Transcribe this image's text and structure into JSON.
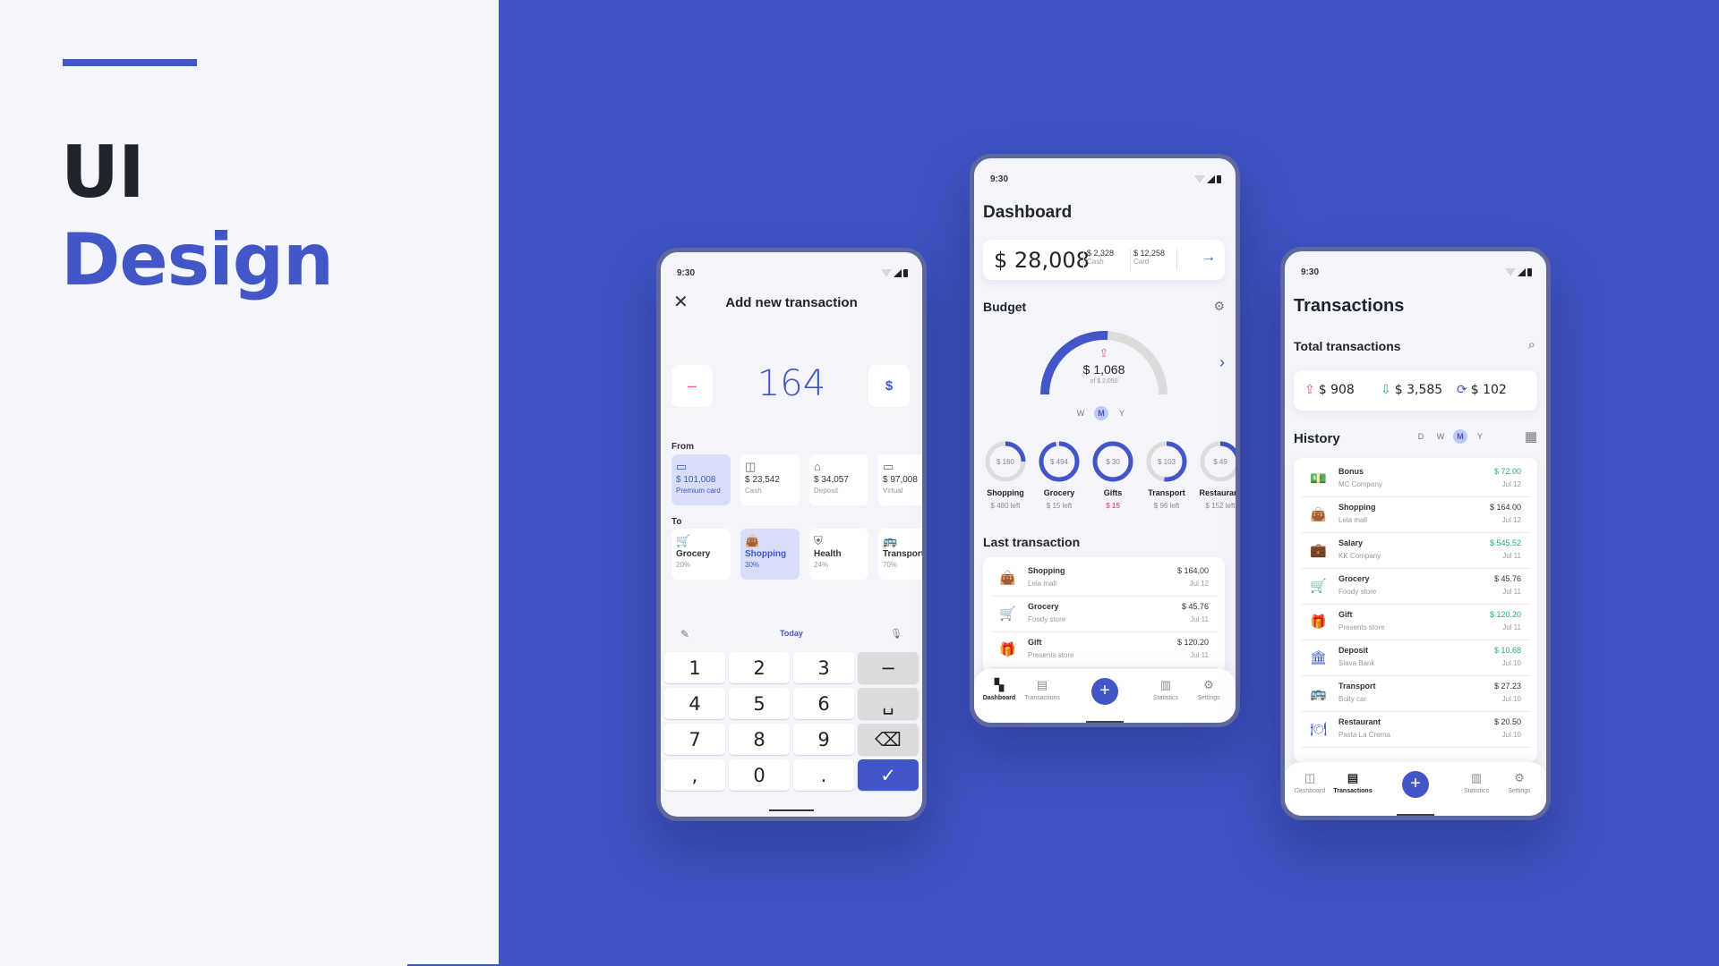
{
  "hero": {
    "line1": "UI",
    "line2": "Design"
  },
  "colors": {
    "accent": "#4356c8",
    "background": "#3f53c3",
    "panel": "#f5f6fb",
    "income": "#1fa98a",
    "expense": "#f0588a"
  },
  "status_time": "9:30",
  "add_transaction": {
    "title": "Add new transaction",
    "close_icon": "close-icon",
    "sign_label": "–",
    "amount": "164",
    "currency_label": "$",
    "from_label": "From",
    "from_accounts": [
      {
        "icon": "card-icon",
        "glyph": "▭",
        "value": "$ 101,008",
        "name": "Premium card",
        "selected": true
      },
      {
        "icon": "wallet-icon",
        "glyph": "◫",
        "value": "$ 23,542",
        "name": "Cash",
        "selected": false
      },
      {
        "icon": "bank-icon",
        "glyph": "⌂",
        "value": "$ 34,057",
        "name": "Deposit",
        "selected": false
      },
      {
        "icon": "card-icon",
        "glyph": "▭",
        "value": "$ 97,008",
        "name": "Virtual",
        "selected": false
      }
    ],
    "to_label": "To",
    "to_categories": [
      {
        "icon": "cart-icon",
        "glyph": "🛒",
        "name": "Grocery",
        "percent": "20%",
        "selected": false
      },
      {
        "icon": "shopping-bag-icon",
        "glyph": "👜",
        "name": "Shopping",
        "percent": "30%",
        "selected": true
      },
      {
        "icon": "health-icon",
        "glyph": "⛨",
        "name": "Health",
        "percent": "24%",
        "selected": false
      },
      {
        "icon": "bus-icon",
        "glyph": "🚌",
        "name": "Transport",
        "percent": "70%",
        "selected": false
      }
    ],
    "date_label": "Today",
    "keypad": [
      [
        "1",
        "2",
        "3",
        "−"
      ],
      [
        "4",
        "5",
        "6",
        "␣"
      ],
      [
        "7",
        "8",
        "9",
        "⌫"
      ],
      [
        ",",
        "0",
        ".",
        "✓"
      ]
    ]
  },
  "dashboard": {
    "title": "Dashboard",
    "balance": {
      "total": "$ 28,008",
      "cash_value": "$ 2,328",
      "cash_label": "Cash",
      "card_value": "$ 12,258",
      "card_label": "Card"
    },
    "budget_label": "Budget",
    "budget": {
      "spent": "$ 1,068",
      "of": "of $ 2,050",
      "fraction": 0.52
    },
    "periods": [
      "W",
      "M",
      "Y"
    ],
    "selected_period": "M",
    "categories": [
      {
        "amount": "$ 160",
        "name": "Shopping",
        "left": "$ 480 left",
        "fraction": 0.25,
        "over": false
      },
      {
        "amount": "$ 494",
        "name": "Grocery",
        "left": "$ 15 left",
        "fraction": 0.97,
        "over": false
      },
      {
        "amount": "$ 30",
        "name": "Gifts",
        "left": "$ 15",
        "fraction": 1.0,
        "over": true
      },
      {
        "amount": "$ 103",
        "name": "Transport",
        "left": "$ 96 left",
        "fraction": 0.52,
        "over": false
      },
      {
        "amount": "$ 49",
        "name": "Restaurant",
        "left": "$ 152 left",
        "fraction": 0.25,
        "over": false
      }
    ],
    "last_label": "Last transaction",
    "last": [
      {
        "icon": "shopping-bag-icon",
        "glyph": "👜",
        "name": "Shopping",
        "merchant": "Lela mall",
        "amount": "$ 164.00",
        "date": "Jul 12",
        "income": false
      },
      {
        "icon": "cart-icon",
        "glyph": "🛒",
        "name": "Grocery",
        "merchant": "Foody store",
        "amount": "$ 45.76",
        "date": "Jul 11",
        "income": false
      },
      {
        "icon": "gift-icon",
        "glyph": "🎁",
        "name": "Gift",
        "merchant": "Presents store",
        "amount": "$ 120.20",
        "date": "Jul 11",
        "income": false
      }
    ]
  },
  "nav": {
    "dashboard": "Dashboard",
    "transactions": "Transactions",
    "add": "+",
    "statistics": "Statistics",
    "settings": "Settings"
  },
  "transactions": {
    "title": "Transactions",
    "total_label": "Total transactions",
    "totals": {
      "outgoing": "$ 908",
      "incoming": "$ 3,585",
      "transfer": "$ 102"
    },
    "history_label": "History",
    "periods": [
      "D",
      "W",
      "M",
      "Y"
    ],
    "selected_period": "M",
    "history": [
      {
        "icon": "money-icon",
        "glyph": "💵",
        "name": "Bonus",
        "merchant": "MC Company",
        "amount": "$ 72.00",
        "date": "Jul 12",
        "income": true
      },
      {
        "icon": "shopping-bag-icon",
        "glyph": "👜",
        "name": "Shopping",
        "merchant": "Lela mall",
        "amount": "$ 164.00",
        "date": "Jul 12",
        "income": false
      },
      {
        "icon": "briefcase-icon",
        "glyph": "💼",
        "name": "Salary",
        "merchant": "KK Company",
        "amount": "$ 545.52",
        "date": "Jul 11",
        "income": true
      },
      {
        "icon": "cart-icon",
        "glyph": "🛒",
        "name": "Grocery",
        "merchant": "Foody store",
        "amount": "$ 45.76",
        "date": "Jul 11",
        "income": false
      },
      {
        "icon": "gift-icon",
        "glyph": "🎁",
        "name": "Gift",
        "merchant": "Presents store",
        "amount": "$ 120.20",
        "date": "Jul 11",
        "income": true
      },
      {
        "icon": "bank-icon",
        "glyph": "🏛",
        "name": "Deposit",
        "merchant": "Slava Bank",
        "amount": "$ 10.68",
        "date": "Jul 10",
        "income": true
      },
      {
        "icon": "bus-icon",
        "glyph": "🚌",
        "name": "Transport",
        "merchant": "Bolty car",
        "amount": "$ 27.23",
        "date": "Jul 10",
        "income": false
      },
      {
        "icon": "restaurant-icon",
        "glyph": "🍽",
        "name": "Restaurant",
        "merchant": "Pasta La Crema",
        "amount": "$ 20.50",
        "date": "Jul 10",
        "income": false
      }
    ]
  }
}
